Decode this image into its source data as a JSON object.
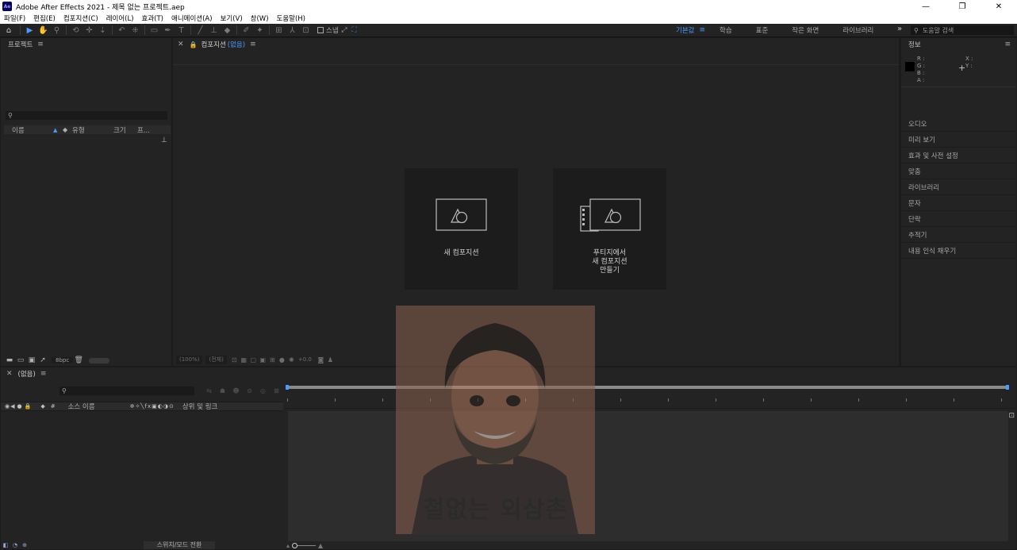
{
  "window": {
    "title": "Adobe After Effects 2021 - 제목 없는 프로젝트.aep",
    "app_badge": "Ae",
    "minimize": "—",
    "maximize": "❐",
    "close": "✕"
  },
  "menu": [
    "파일(F)",
    "편집(E)",
    "컴포지션(C)",
    "레이어(L)",
    "효과(T)",
    "애니메이션(A)",
    "보기(V)",
    "창(W)",
    "도움말(H)"
  ],
  "toolbar": {
    "snap_label": "스냅",
    "workspaces": [
      "기본값",
      "학습",
      "표준",
      "작은 화면",
      "라이브러리"
    ],
    "active_workspace": "기본값",
    "help_search_placeholder": "도움말 검색",
    "accent": "#4a9bff"
  },
  "project": {
    "title": "프로젝트",
    "columns": {
      "name": "이름",
      "type": "유형",
      "size": "크기",
      "duration": "프..."
    },
    "bpc": "8bpc"
  },
  "composition": {
    "tab_label": "컴포지션",
    "tab_sub": "(없음)",
    "cards": [
      {
        "label": "새 컴포지션"
      },
      {
        "label": "푸티지에서\n새 컴포지션\n만들기"
      }
    ],
    "footer": {
      "zoom": "(100%)",
      "resolution": "(전체)",
      "exposure": "+0.0"
    }
  },
  "info": {
    "title": "정보",
    "rgba": [
      "R :",
      "G :",
      "B :",
      "A :"
    ],
    "xy": [
      "X :",
      "Y :"
    ],
    "panels": [
      "오디오",
      "미리 보기",
      "효과 및 사전 설정",
      "맞춤",
      "라이브러리",
      "문자",
      "단락",
      "추적기",
      "내용 인식 채우기"
    ]
  },
  "timeline": {
    "tab_label": "(없음)",
    "columns": {
      "source_name": "소스 이름",
      "parent": "상위 및 링크"
    },
    "switch_mode": "스위치/모드 전환"
  },
  "overlay": {
    "caption": "철없는 외삼촌"
  }
}
